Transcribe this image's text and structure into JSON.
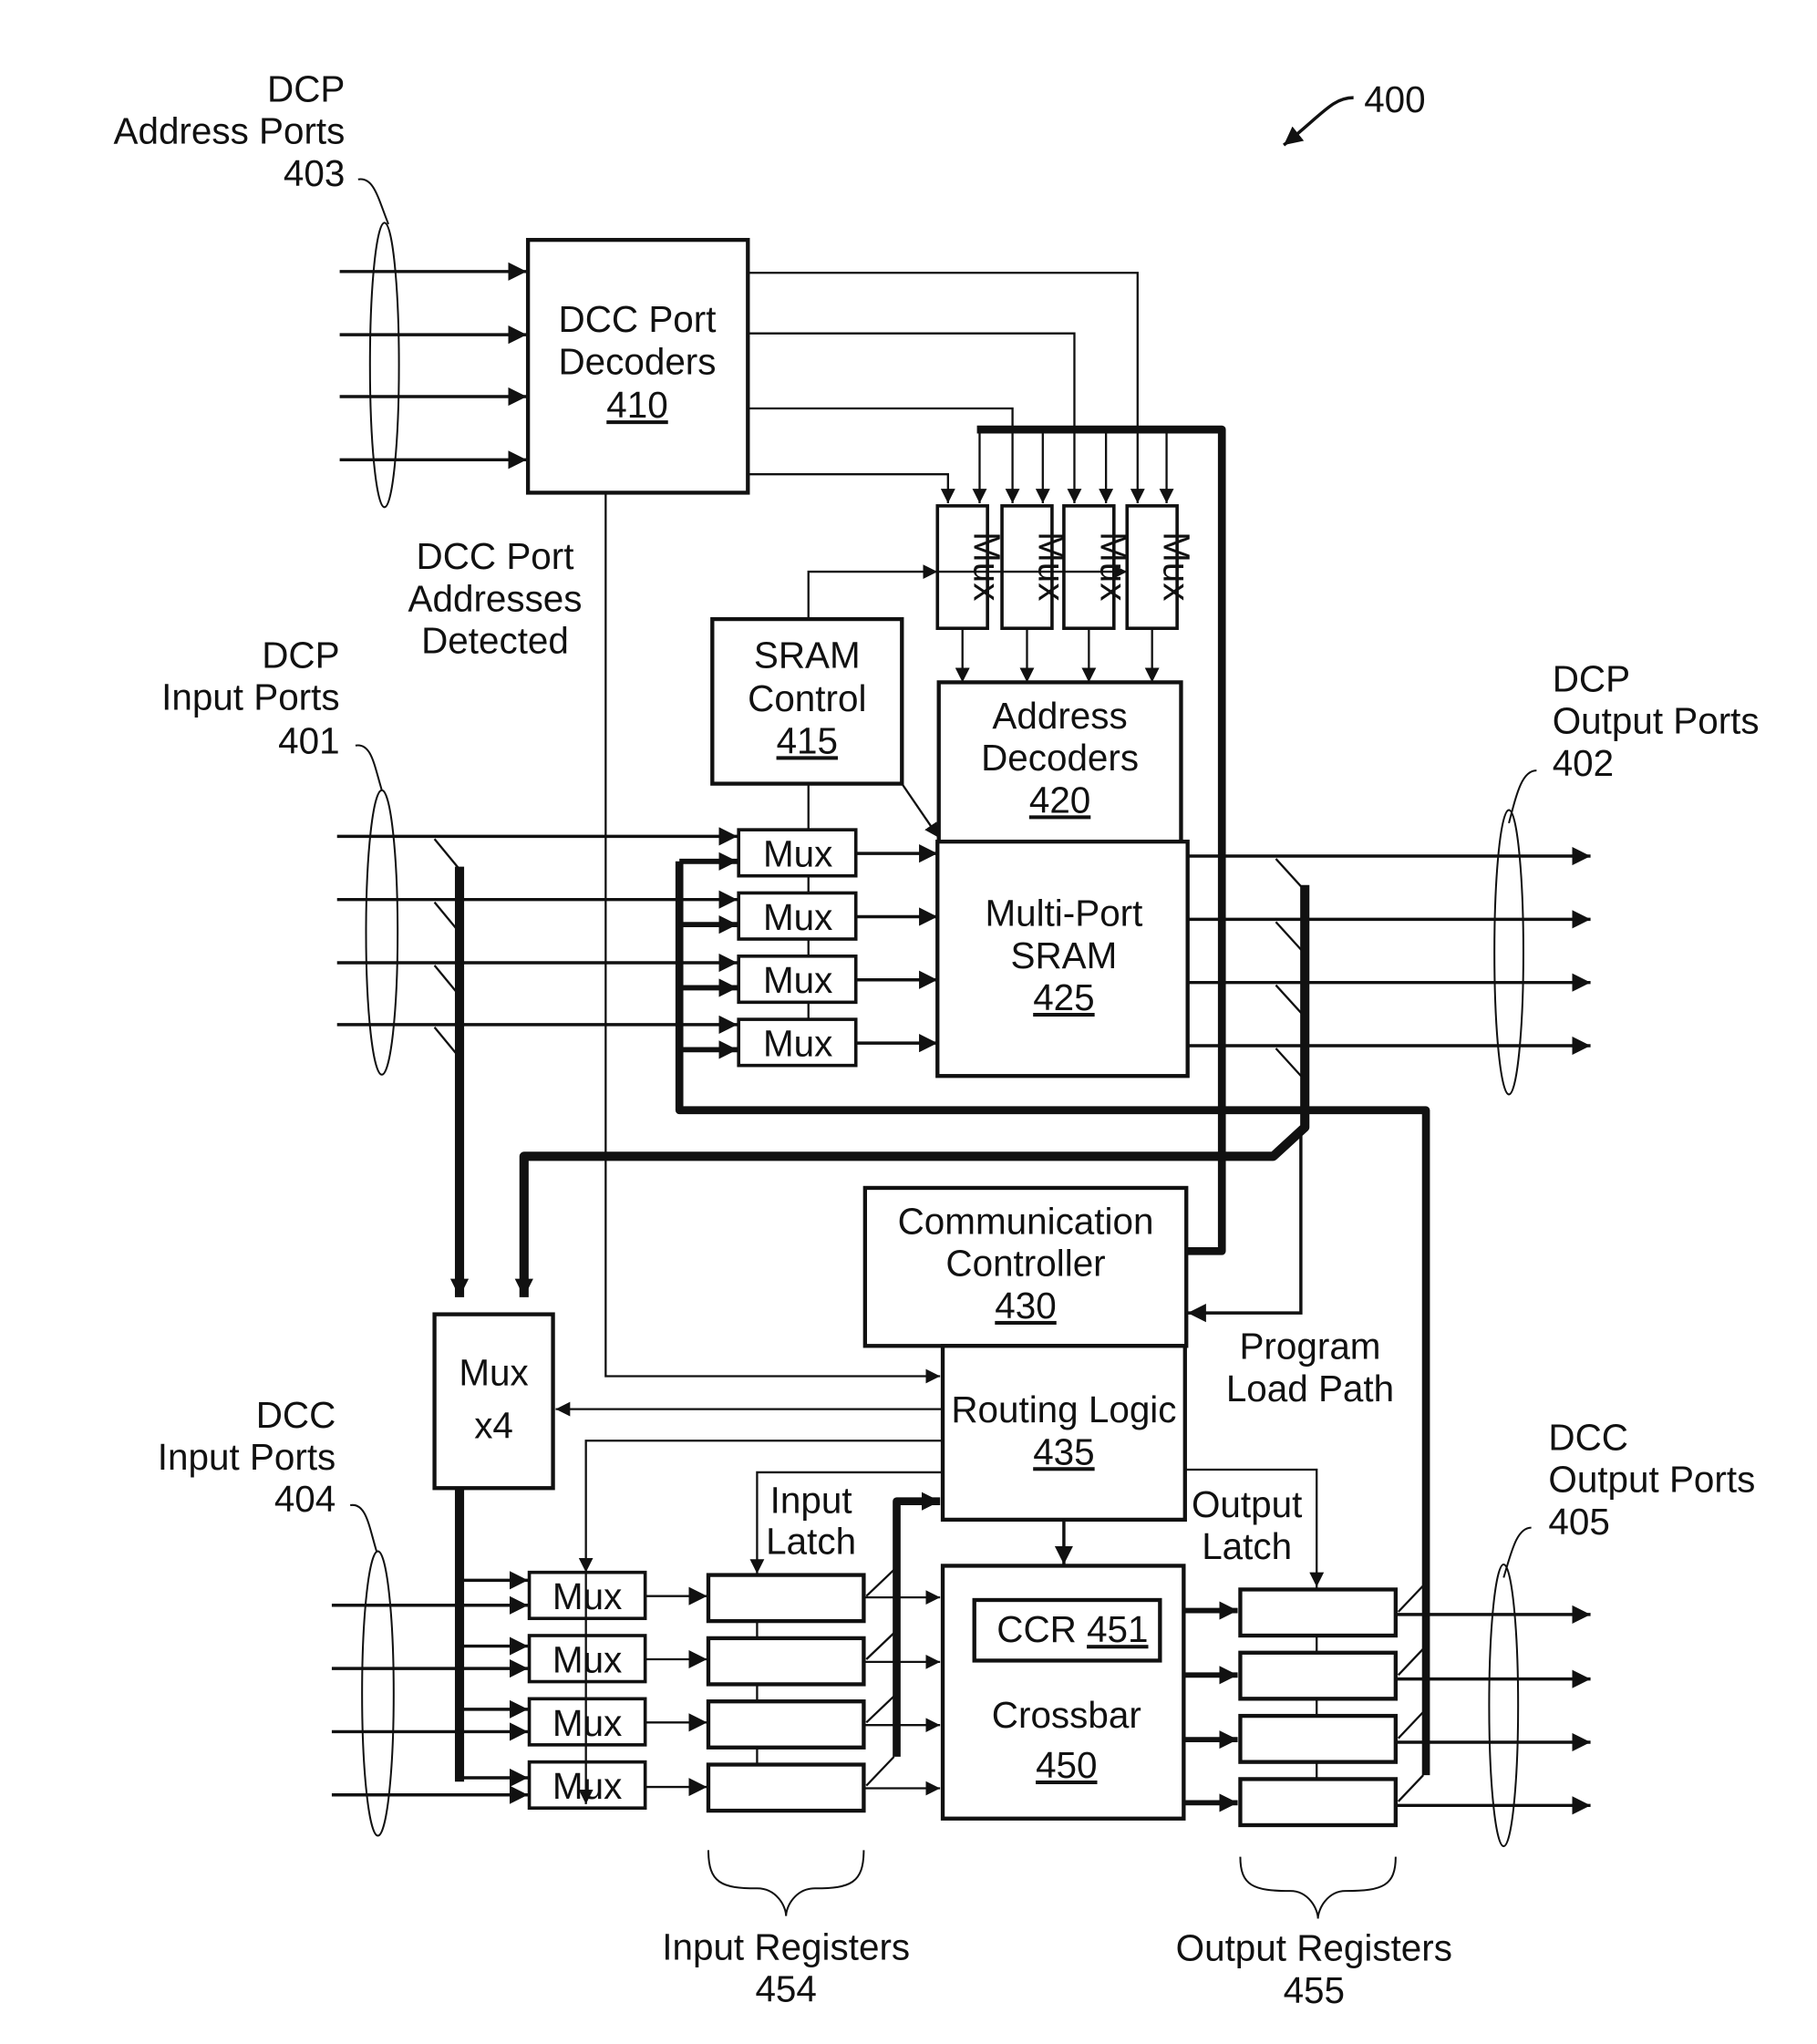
{
  "figure": {
    "ref": "400",
    "colors": {
      "ink": "#111111",
      "paper": "#ffffff"
    }
  },
  "blocks": {
    "dcc_port_decoders": {
      "line1": "DCC Port",
      "line2": "Decoders",
      "ref": "410"
    },
    "sram_control": {
      "line1": "SRAM",
      "line2": "Control",
      "ref": "415"
    },
    "address_decoders": {
      "line1": "Address",
      "line2": "Decoders",
      "ref": "420"
    },
    "multi_port_sram": {
      "line1": "Multi-Port",
      "line2": "SRAM",
      "ref": "425"
    },
    "communication_controller": {
      "line1": "Communication",
      "line2": "Controller",
      "ref": "430"
    },
    "routing_logic": {
      "line1": "Routing Logic",
      "ref": "435"
    },
    "crossbar": {
      "line1": "Crossbar",
      "ref": "450"
    },
    "ccr": {
      "label": "CCR",
      "ref": "451"
    },
    "mux_x4": {
      "line1": "Mux",
      "line2": "x4"
    },
    "mux_label": "Mux"
  },
  "labels": {
    "dcp_address_ports": {
      "line1": "DCP",
      "line2": "Address Ports",
      "ref": "403"
    },
    "dcp_input_ports": {
      "line1": "DCP",
      "line2": "Input Ports",
      "ref": "401"
    },
    "dcp_output_ports": {
      "line1": "DCP",
      "line2": "Output Ports",
      "ref": "402"
    },
    "dcc_input_ports": {
      "line1": "DCC",
      "line2": "Input Ports",
      "ref": "404"
    },
    "dcc_output_ports": {
      "line1": "DCC",
      "line2": "Output Ports",
      "ref": "405"
    },
    "dcc_port_addresses": {
      "line1": "DCC Port",
      "line2": "Addresses",
      "line3": "Detected"
    },
    "program_load_path": {
      "line1": "Program",
      "line2": "Load Path"
    },
    "input_latch": {
      "line1": "Input",
      "line2": "Latch"
    },
    "output_latch": {
      "line1": "Output",
      "line2": "Latch"
    },
    "input_registers": {
      "line1": "Input Registers",
      "ref": "454"
    },
    "output_registers": {
      "line1": "Output Registers",
      "ref": "455"
    }
  }
}
